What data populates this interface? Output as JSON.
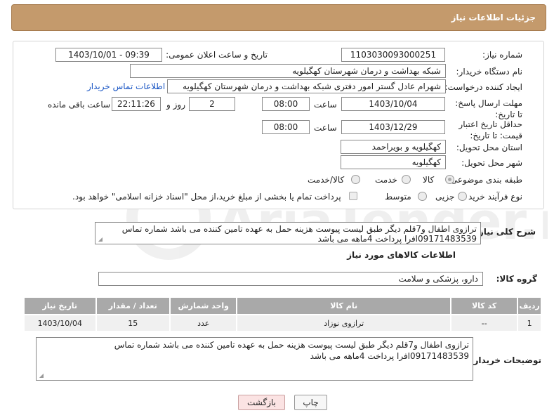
{
  "header": {
    "title": "جزئیات اطلاعات نیاز"
  },
  "fields": {
    "need_number_label": "شماره نیاز:",
    "need_number": "1103030093000251",
    "announce_label": "تاریخ و ساعت اعلان عمومی:",
    "announce_value": "1403/10/01 - 09:39",
    "buyer_org_label": "نام دستگاه خریدار:",
    "buyer_org": "شبکه بهداشت و درمان شهرستان کهگیلویه",
    "creator_label": "ایجاد کننده درخواست:",
    "creator": "شهرام عادل گستر امور دفتری شبکه بهداشت و درمان شهرستان کهگیلویه",
    "contact_link": "اطلاعات تماس خریدار",
    "reply_deadline_label": "مهلت ارسال پاسخ: تا تاریخ:",
    "reply_date": "1403/10/04",
    "time_label": "ساعت",
    "reply_time": "08:00",
    "days_value": "2",
    "days_label": "روز و",
    "remaining_time": "22:11:26",
    "remaining_label": "ساعت باقی مانده",
    "price_validity_label": "حداقل تاریخ اعتبار قیمت: تا تاریخ:",
    "price_date": "1403/12/29",
    "price_time": "08:00",
    "province_label": "استان محل تحویل:",
    "province": "کهگیلویه و بویراحمد",
    "city_label": "شهر محل تحویل:",
    "city": "کهگیلویه",
    "category_label": "طبقه بندی موضوعی:",
    "category_options": [
      "کالا",
      "خدمت",
      "کالا/خدمت"
    ],
    "category_selected": "کالا",
    "process_label": "نوع فرآیند خرید :",
    "process_options": [
      "جزیی",
      "متوسط"
    ],
    "process_note": "پرداخت تمام یا بخشی از مبلغ خرید،از محل \"اسناد خزانه اسلامی\" خواهد بود."
  },
  "summary": {
    "label": "شرح کلی نیاز:",
    "text": "ترازوی اطفال و7قلم دیگر طبق لیست پیوست هزینه حمل به عهده تامین کننده می باشد شماره تماس 09171483539افرا  پرداخت 4ماهه می باشد"
  },
  "goods_section": {
    "title": "اطلاعات کالاهای مورد نیاز",
    "group_label": "گروه کالا:",
    "group_value": "دارو، پزشکی و سلامت"
  },
  "table": {
    "headers": [
      "ردیف",
      "کد کالا",
      "نام کالا",
      "واحد شمارش",
      "تعداد / مقدار",
      "تاریخ نیاز"
    ],
    "rows": [
      [
        "1",
        "--",
        "ترازوی نوزاد",
        "عدد",
        "15",
        "1403/10/04"
      ]
    ]
  },
  "buyer_notes": {
    "label": "توضیحات خریدار:",
    "text": "ترازوی اطفال و7قلم دیگر طبق لیست پیوست هزینه حمل به عهده تامین کننده می باشد شماره تماس 09171483539افرا پرداخت 4ماهه می باشد"
  },
  "buttons": {
    "print": "چاپ",
    "back": "بازگشت"
  },
  "watermark": {
    "text": "AriaTender.net"
  }
}
